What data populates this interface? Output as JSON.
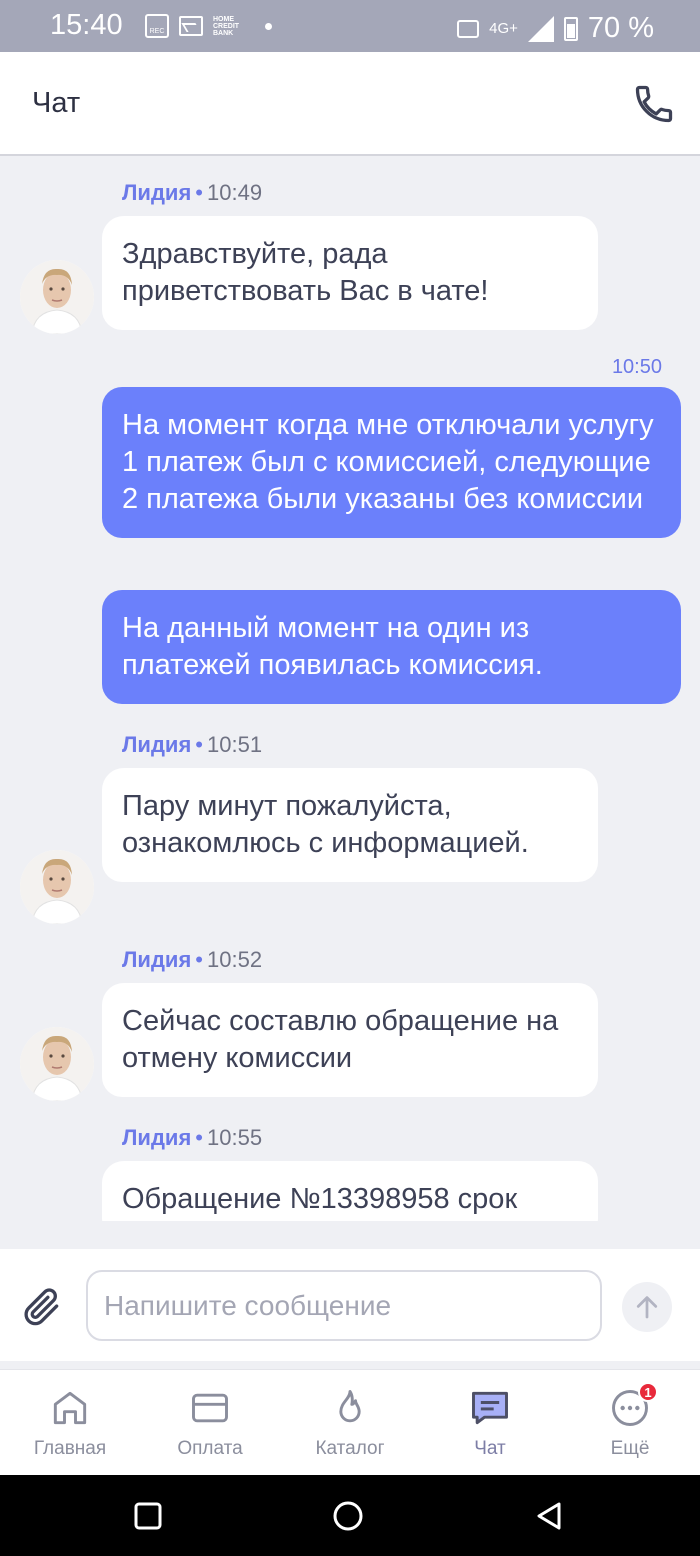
{
  "status_bar": {
    "time": "15:40",
    "rec_label": "REC",
    "bank_label": "HOME CREDIT BANK",
    "network": "4G+",
    "battery": "70 %"
  },
  "header": {
    "title": "Чат",
    "call_icon": "phone-icon"
  },
  "messages": [
    {
      "type": "meta",
      "author": "Лидия",
      "time": "10:49"
    },
    {
      "type": "incoming",
      "text": "Здравствуйте, рада приветствовать Вас в чате!"
    },
    {
      "type": "meta-right",
      "time": "10:50"
    },
    {
      "type": "outgoing",
      "text": "На момент когда мне отключали услугу 1 платеж был с комиссией, следующие 2 платежа были указаны без комиссии"
    },
    {
      "type": "outgoing",
      "text": "На данный момент на один из платежей появилась комиссия."
    },
    {
      "type": "meta",
      "author": "Лидия",
      "time": "10:51"
    },
    {
      "type": "incoming",
      "text": "Пару минут пожалуйста, ознакомлюсь с информацией."
    },
    {
      "type": "meta",
      "author": "Лидия",
      "time": "10:52"
    },
    {
      "type": "incoming",
      "text": "Сейчас составлю обращение на отмену комиссии"
    },
    {
      "type": "meta",
      "author": "Лидия",
      "time": "10:55"
    },
    {
      "type": "incoming",
      "text": "Обращение №13398958 срок"
    }
  ],
  "input": {
    "placeholder": "Напишите сообщение",
    "value": "",
    "attach_icon": "paperclip-icon",
    "send_icon": "arrow-up-icon"
  },
  "nav": {
    "items": [
      {
        "label": "Главная",
        "icon": "home-icon",
        "active": false
      },
      {
        "label": "Оплата",
        "icon": "card-icon",
        "active": false
      },
      {
        "label": "Каталог",
        "icon": "fire-icon",
        "active": false
      },
      {
        "label": "Чат",
        "icon": "chat-icon",
        "active": true
      },
      {
        "label": "Ещё",
        "icon": "more-icon",
        "active": false,
        "badge": "1"
      }
    ]
  },
  "colors": {
    "accent": "#6b79e8",
    "outgoing_bubble": "#6b80fb",
    "background": "#eff0f4",
    "badge": "#e8293b"
  }
}
